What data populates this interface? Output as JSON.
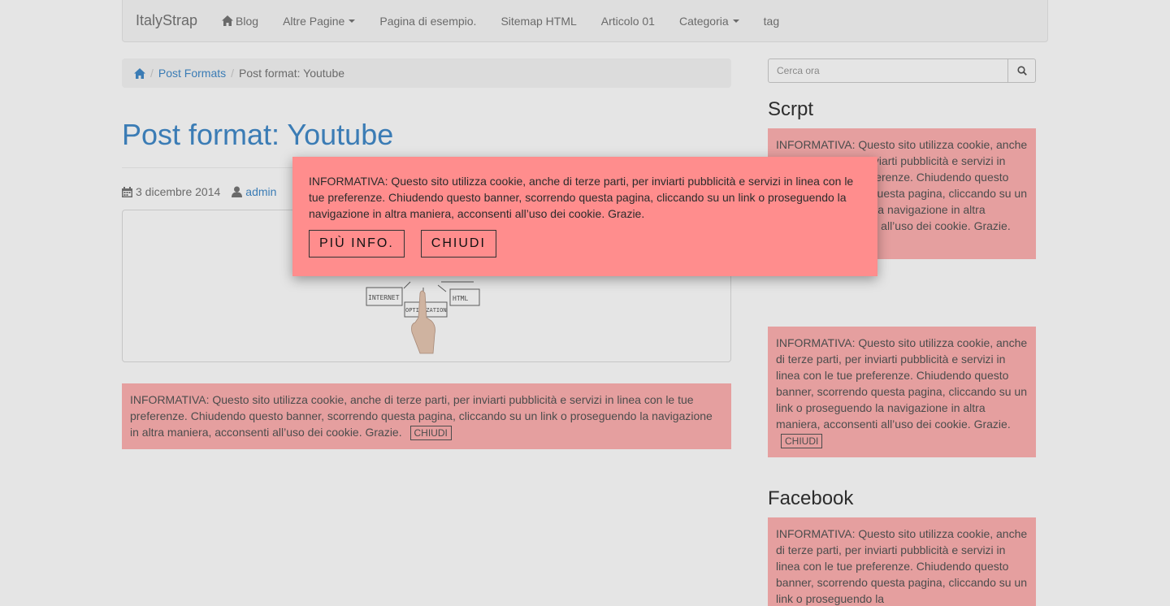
{
  "navbar": {
    "brand": "ItalyStrap",
    "items": [
      {
        "label": "Blog"
      },
      {
        "label": "Altre Pagine"
      },
      {
        "label": "Pagina di esempio."
      },
      {
        "label": "Sitemap HTML"
      },
      {
        "label": "Articolo 01"
      },
      {
        "label": "Categoria"
      },
      {
        "label": "tag"
      }
    ]
  },
  "breadcrumb": {
    "link": "Post Formats",
    "active": "Post format: Youtube"
  },
  "post": {
    "title": "Post format: Youtube",
    "date": "3 dicembre 2014",
    "author": "admin"
  },
  "thumbnail": {
    "labels": [
      "INTERNET",
      "OPTIMIZATION",
      "HTML"
    ]
  },
  "cookie": {
    "short_text": "INFORMATIVA: Questo sito utilizza cookie, anche di terze parti, per inviarti pubblicità e servizi in linea con le tue preferenze. Chiudendo questo banner, scorrendo questa pagina, cliccando su un link o proseguendo la navigazione in altra maniera, acconsenti all’uso dei cookie. Grazie.",
    "close_label": "CHIUDI"
  },
  "sidebar": {
    "search_placeholder": "Cerca ora",
    "widget_1_title": "Scrpt",
    "widget_2_title": "Facebook",
    "box_4_text": "INFORMATIVA: Questo sito utilizza cookie, anche di terze parti, per inviarti pubblicità e servizi in linea con le tue preferenze. Chiudendo questo banner, scorrendo questa pagina, cliccando su un link o proseguendo la"
  },
  "popup": {
    "text": "INFORMATIVA: Questo sito utilizza cookie, anche di terze parti, per inviarti pubblicità e servizi in linea con le tue preferenze. Chiudendo questo banner, scorrendo questa pagina, cliccando su un link o proseguendo la navigazione in altra maniera, acconsenti all’uso dei cookie. Grazie.",
    "more_info_label": "PIÙ INFO.",
    "close_label": "CHIUDI"
  },
  "colors": {
    "accent": "#428bca",
    "cookie_bg": "#ffb2b2",
    "popup_bg": "#ff8d8d"
  }
}
